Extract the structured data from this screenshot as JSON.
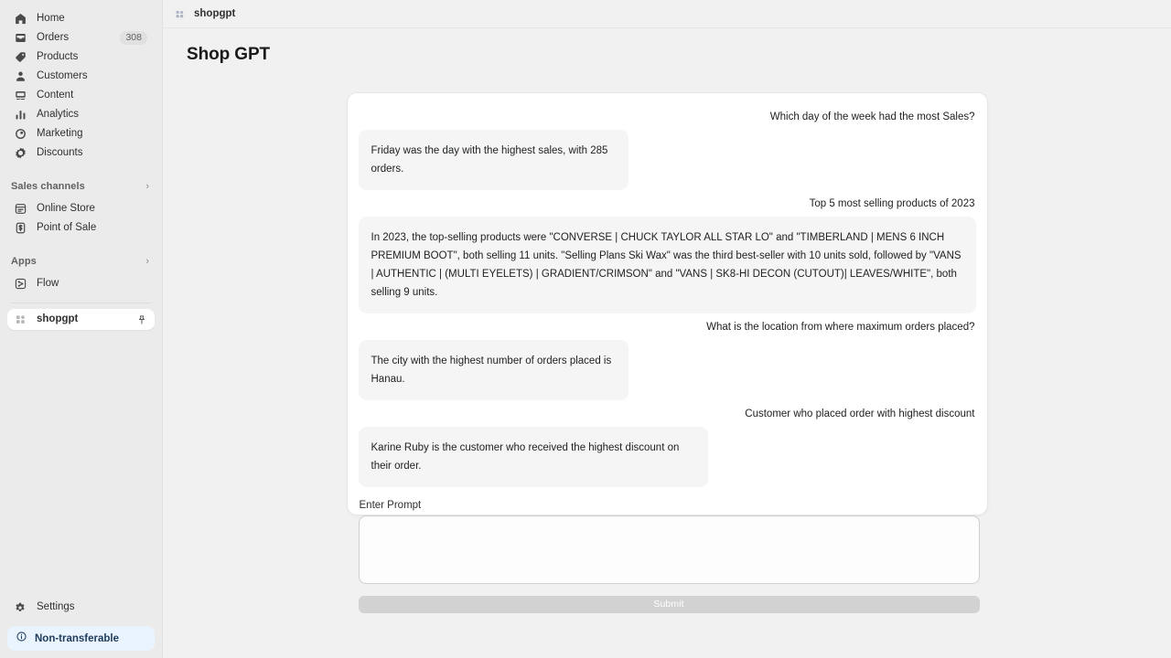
{
  "sidebar": {
    "nav": [
      {
        "label": "Home",
        "icon": "home-icon"
      },
      {
        "label": "Orders",
        "icon": "orders-icon",
        "badge": "308"
      },
      {
        "label": "Products",
        "icon": "products-icon"
      },
      {
        "label": "Customers",
        "icon": "customers-icon"
      },
      {
        "label": "Content",
        "icon": "content-icon"
      },
      {
        "label": "Analytics",
        "icon": "analytics-icon"
      },
      {
        "label": "Marketing",
        "icon": "marketing-icon"
      },
      {
        "label": "Discounts",
        "icon": "discounts-icon"
      }
    ],
    "sales_channels": {
      "title": "Sales channels",
      "items": [
        {
          "label": "Online Store",
          "icon": "online-store-icon"
        },
        {
          "label": "Point of Sale",
          "icon": "point-of-sale-icon"
        }
      ]
    },
    "apps": {
      "title": "Apps",
      "items": [
        {
          "label": "Flow",
          "icon": "flow-icon"
        }
      ],
      "active_app": {
        "label": "shopgpt",
        "icon": "shopgpt-icon",
        "pin_icon": "pin-icon"
      }
    },
    "settings": {
      "label": "Settings",
      "icon": "gear-icon"
    },
    "banner": {
      "label": "Non-transferable",
      "icon": "info-icon",
      "bg": "#eaf4fe",
      "fg": "#1d3c5c"
    }
  },
  "breadcrumb": {
    "label": "shopgpt",
    "icon": "app-icon"
  },
  "page": {
    "title": "Shop GPT"
  },
  "chat": {
    "messages": [
      {
        "role": "user",
        "text": "Which day of the week had the most Sales?"
      },
      {
        "role": "bot",
        "text": "Friday was the day with the highest sales, with 285 orders.",
        "width": "narrow"
      },
      {
        "role": "user",
        "text": "Top 5 most selling products of 2023"
      },
      {
        "role": "bot",
        "text": "In 2023, the top-selling products were \"CONVERSE | CHUCK TAYLOR ALL STAR LO\" and \"TIMBERLAND | MENS 6 INCH PREMIUM BOOT\", both selling 11 units. \"Selling Plans Ski Wax\" was the third best-seller with 10 units sold, followed by \"VANS | AUTHENTIC | (MULTI EYELETS) | GRADIENT/CRIMSON\" and \"VANS | SK8-HI DECON (CUTOUT)| LEAVES/WHITE\", both selling 9 units.",
        "width": "full"
      },
      {
        "role": "user",
        "text": "What is the location from where maximum orders placed?"
      },
      {
        "role": "bot",
        "text": "The city with the highest number of orders placed is Hanau.",
        "width": "narrow"
      },
      {
        "role": "user",
        "text": "Customer who placed order with highest discount"
      },
      {
        "role": "bot",
        "text": "Karine Ruby is the customer who received the highest discount on their order.",
        "width": "mid"
      }
    ]
  },
  "prompt": {
    "label": "Enter Prompt",
    "value": "",
    "placeholder": "",
    "submit_label": "Submit",
    "submit_disabled": true
  }
}
